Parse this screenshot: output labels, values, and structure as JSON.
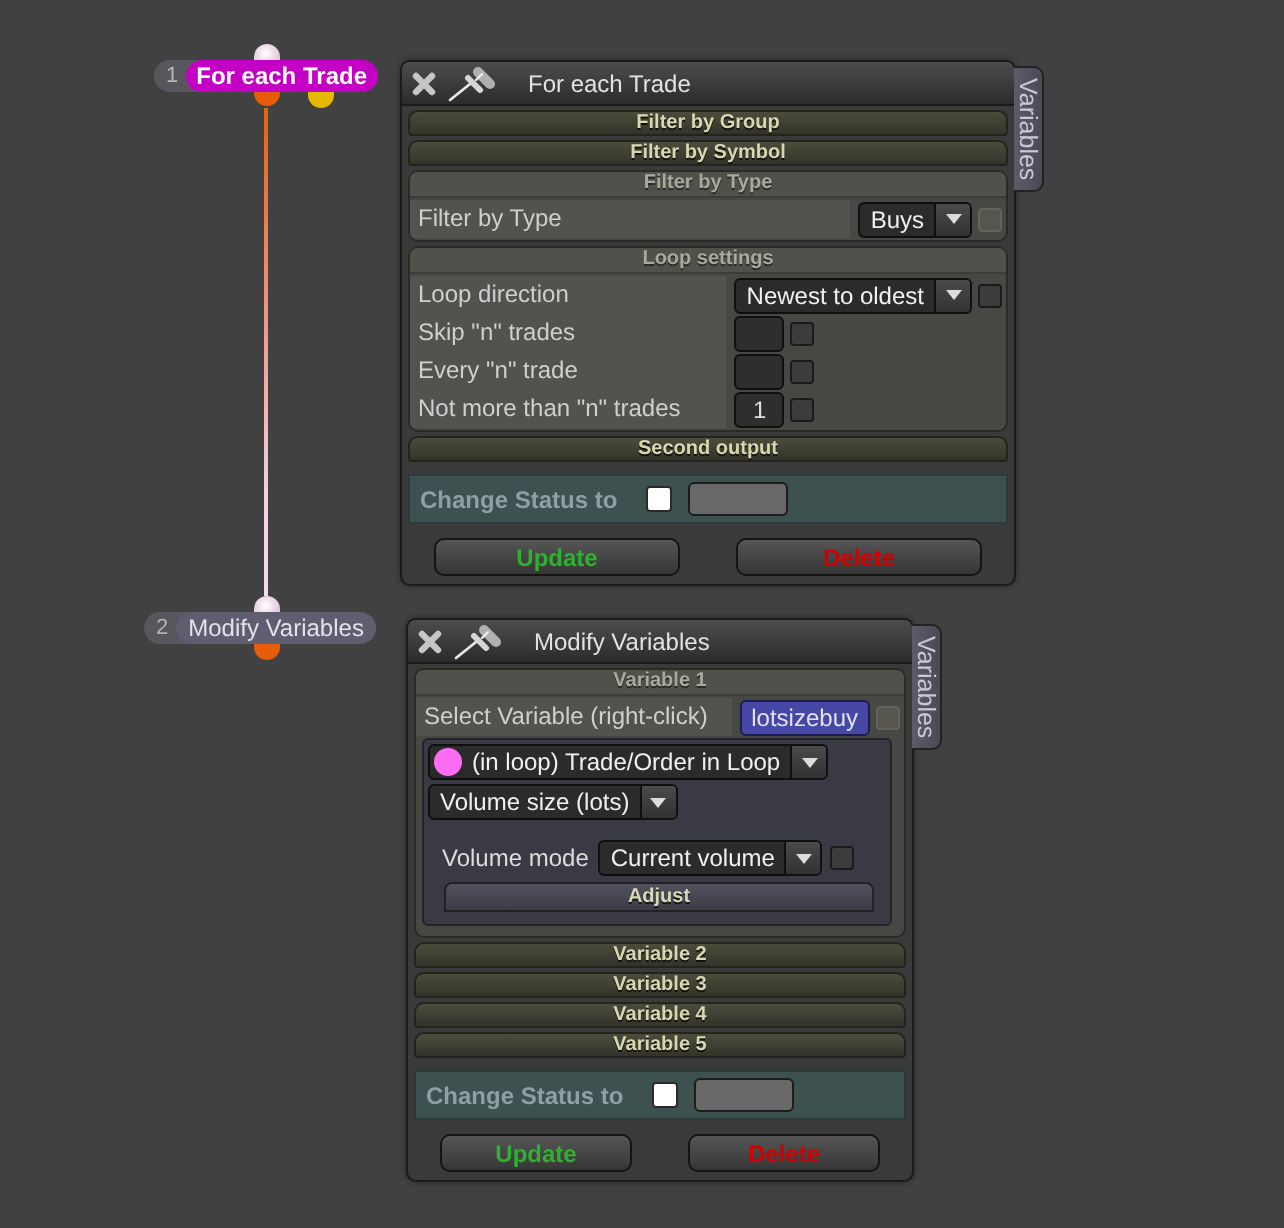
{
  "nodes": [
    {
      "number": "1",
      "label": "For each Trade",
      "selected": true,
      "outputs": [
        {
          "color": "#e65c0a"
        },
        {
          "color": "#e6b800"
        }
      ]
    },
    {
      "number": "2",
      "label": "Modify Variables",
      "selected": false,
      "outputs": [
        {
          "color": "#e65c0a"
        }
      ]
    }
  ],
  "panels": [
    {
      "title": "For each Trade",
      "side_tab": "Variables",
      "sections": [
        {
          "title": "Filter by Group",
          "expanded": false
        },
        {
          "title": "Filter by Symbol",
          "expanded": false
        },
        {
          "title": "Filter by Type",
          "expanded": true,
          "rows": [
            {
              "kind": "select",
              "label": "Filter by Type",
              "value": "Buys",
              "checkbox": {
                "checked": false,
                "disabled": true
              }
            }
          ]
        },
        {
          "title": "Loop settings",
          "expanded": true,
          "rows": [
            {
              "kind": "select",
              "label": "Loop direction",
              "value": "Newest to oldest",
              "checkbox": {
                "checked": false,
                "disabled": false
              }
            },
            {
              "kind": "input",
              "label": "Skip \"n\" trades",
              "checkbox": {
                "checked": false,
                "disabled": false
              }
            },
            {
              "kind": "input",
              "label": "Every \"n\" trade",
              "checkbox": {
                "checked": false,
                "disabled": false
              }
            },
            {
              "kind": "input",
              "label": "Not more than \"n\" trades",
              "value": "1",
              "checkbox": {
                "checked": false,
                "disabled": false
              }
            }
          ]
        },
        {
          "title": "Second output",
          "expanded": false
        }
      ],
      "status": {
        "label": "Change Status to",
        "checked": false
      },
      "buttons": [
        {
          "label": "Update",
          "kind": "update"
        },
        {
          "label": "Delete",
          "kind": "delete"
        }
      ]
    },
    {
      "title": "Modify Variables",
      "side_tab": "Variables",
      "sections": [
        {
          "title": "Variable 1",
          "expanded": true,
          "rows": [
            {
              "kind": "variable",
              "label": "Select Variable (right-click)",
              "value": "lotsizebuy",
              "checkbox": {
                "checked": false,
                "disabled": true
              }
            },
            {
              "kind": "group",
              "rows": [
                {
                  "kind": "source",
                  "value": "(in loop) Trade/Order in Loop"
                },
                {
                  "kind": "dropdown",
                  "value": "Volume size (lots)"
                },
                {
                  "kind": "select",
                  "label": "Volume mode",
                  "value": "Current volume",
                  "checkbox": {
                    "checked": false,
                    "disabled": false
                  }
                },
                {
                  "kind": "button",
                  "label": "Adjust"
                }
              ]
            }
          ]
        },
        {
          "title": "Variable 2",
          "expanded": false
        },
        {
          "title": "Variable 3",
          "expanded": false
        },
        {
          "title": "Variable 4",
          "expanded": false
        },
        {
          "title": "Variable 5",
          "expanded": false
        }
      ],
      "status": {
        "label": "Change Status to",
        "checked": false
      },
      "buttons": [
        {
          "label": "Update",
          "kind": "update"
        },
        {
          "label": "Delete",
          "kind": "delete"
        }
      ]
    }
  ]
}
